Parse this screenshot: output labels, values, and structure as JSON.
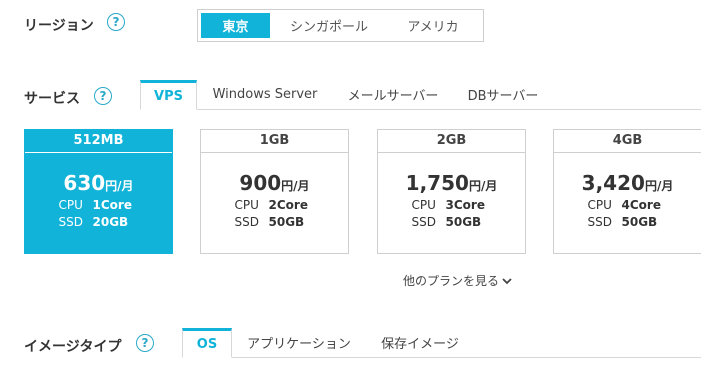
{
  "colors": {
    "accent": "#12b3d8",
    "help": "#2aa9c9",
    "border": "#cfcfcf"
  },
  "region": {
    "label": "リージョン",
    "help": "?",
    "options": [
      {
        "label": "東京",
        "active": true
      },
      {
        "label": "シンガポール",
        "active": false
      },
      {
        "label": "アメリカ",
        "active": false
      }
    ]
  },
  "service": {
    "label": "サービス",
    "help": "?",
    "tabs": [
      {
        "label": "VPS",
        "active": true
      },
      {
        "label": "Windows Server",
        "active": false
      },
      {
        "label": "メールサーバー",
        "active": false
      },
      {
        "label": "DBサーバー",
        "active": false
      }
    ]
  },
  "plans": [
    {
      "name": "512MB",
      "price": "630",
      "unit": "円/月",
      "cpu_label": "CPU",
      "cpu": "1Core",
      "ssd_label": "SSD",
      "ssd": "20GB",
      "active": true
    },
    {
      "name": "1GB",
      "price": "900",
      "unit": "円/月",
      "cpu_label": "CPU",
      "cpu": "2Core",
      "ssd_label": "SSD",
      "ssd": "50GB",
      "active": false
    },
    {
      "name": "2GB",
      "price": "1,750",
      "unit": "円/月",
      "cpu_label": "CPU",
      "cpu": "3Core",
      "ssd_label": "SSD",
      "ssd": "50GB",
      "active": false
    },
    {
      "name": "4GB",
      "price": "3,420",
      "unit": "円/月",
      "cpu_label": "CPU",
      "cpu": "4Core",
      "ssd_label": "SSD",
      "ssd": "50GB",
      "active": false
    }
  ],
  "more_plans": {
    "label": "他のプランを見る",
    "icon": "chevron-down-icon"
  },
  "image_type": {
    "label": "イメージタイプ",
    "help": "?",
    "tabs": [
      {
        "label": "OS",
        "active": true
      },
      {
        "label": "アプリケーション",
        "active": false
      },
      {
        "label": "保存イメージ",
        "active": false
      }
    ]
  }
}
